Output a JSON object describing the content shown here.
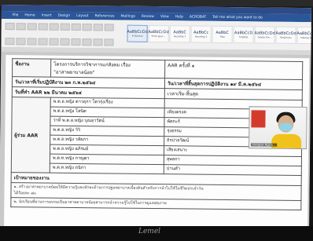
{
  "menu": [
    "File",
    "Home",
    "Insert",
    "Design",
    "Layout",
    "References",
    "Mailings",
    "Review",
    "View",
    "Help",
    "ACROBAT",
    "Tell me what you want to do"
  ],
  "styles": [
    {
      "sample": "AaBbCcDd",
      "name": "¶ Normal",
      "selected": true
    },
    {
      "sample": "AaBbCcDd",
      "name": "¶ No Spac..."
    },
    {
      "sample": "AaBbC",
      "name": "Heading 1"
    },
    {
      "sample": "AaBbCc",
      "name": "Heading 2"
    },
    {
      "sample": "AaBbC",
      "name": "Title"
    },
    {
      "sample": "AaBbCcD",
      "name": "Subtitle"
    },
    {
      "sample": "AaBbCcDd",
      "name": "Subtle Em..."
    },
    {
      "sample": "AaBbCcDd",
      "name": "Emphasis"
    },
    {
      "sample": "AaBbCcDd",
      "name": "Intense E..."
    },
    {
      "sample": "AaBbCcDd",
      "name": "Strong"
    }
  ],
  "doc": {
    "project_label": "ชื่องาน",
    "project_value": "โครงการบริการวิชาการแก่สังคม เรื่อง",
    "project_value2": "\"อาสาพยาบาลน้อย\"",
    "aar_number": "AAR ครั้งที่ ๑",
    "start_label": "วัน/เวลาที่เริ่มปฏิบัติงาน ๒๓ ก.พ.๒๕๖๔",
    "end_label": "วัน/เวลาที่สิ้นสุดการปฏิบัติงาน ๑๙ มี.ค.๒๕๖๔",
    "aar_date": "วันที่ทำ AAR ๒๒ มีนาคม ๒๕๖๔",
    "time_label": "เวลาเริ่ม-สิ้นสุด",
    "participants_label": "ผู้ร่วม AAR",
    "members": [
      {
        "name": "พ.ต.อ.หญิง ดาวฤกา  โตวรุ่งเรือง",
        "role": ""
      },
      {
        "name": "พ.ต.อ.หญิง โสนิต",
        "role": "เทียงตรงค"
      },
      {
        "name": "ว่าที่ พ.ต.อ.หญิง บุณยาวัตน์",
        "role": "พัดกะร์"
      },
      {
        "name": "พ.ต.อ.หญิง วิวิ",
        "role": "รุ่งธรรม"
      },
      {
        "name": "พ.ต.อ.หญิง วลัยภา",
        "role": "ถิรปาลวัฒน์"
      },
      {
        "name": "พ.ต.อ.หญิง อภิรมย์",
        "role": "เสียงเสนาะ"
      },
      {
        "name": "พ.ต.ท.หญิง กาญดา",
        "role": "สุพลกา"
      },
      {
        "name": "พ.ต.ท.หญิง ถนิกา",
        "role": "ปานคำ"
      }
    ],
    "goals_title": "เป้าหมายของงาน",
    "goal1": "๑. สร้างอาสาพยาบาลน้อยให้มีความรู้และทักษะด้านการปฐมพยาบาลเบื้องต้นสำหรับการนำไปใช้ในชีวิตประจำวัน",
    "goal1_cont": "ได้ร้อยละ ๘๐",
    "goal2": "๒. นักเรียนที่ผ่านการอบรมเป็นอาสาพยาบาลน้อยสามารถนำความรู้ไปใช้ในการดูแลสุขภาพ"
  },
  "video_name": "Nonglak Ngam...",
  "brand": "Lemel"
}
